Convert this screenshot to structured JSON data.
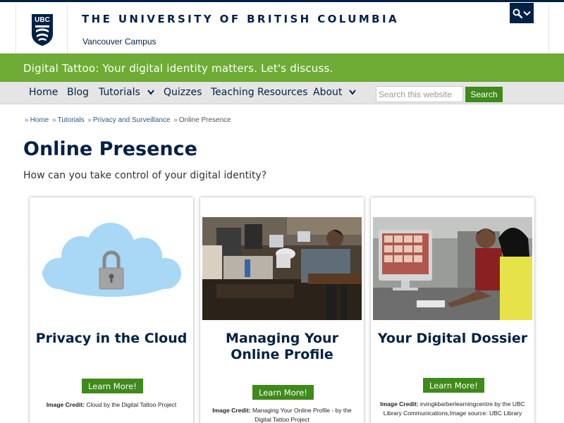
{
  "header": {
    "crest_text": "UBC",
    "university_name": "THE UNIVERSITY OF BRITISH COLUMBIA",
    "campus": "Vancouver Campus"
  },
  "banner": {
    "text": "Digital Tattoo: Your digital identity matters. Let's discuss."
  },
  "nav": {
    "items": [
      {
        "label": "Home"
      },
      {
        "label": "Blog"
      },
      {
        "label": "Tutorials"
      },
      {
        "label": "Quizzes"
      },
      {
        "label": "Teaching Resources"
      },
      {
        "label": "About"
      }
    ],
    "search_placeholder": "Search this website",
    "search_button": "Search"
  },
  "breadcrumb": {
    "prefix": "»",
    "items": [
      "Home",
      "Tutorials",
      "Privacy and Surveillance",
      "Online Presence"
    ]
  },
  "page": {
    "title": "Online Presence",
    "subtitle": "How can you take control of your digital identity?"
  },
  "cards": [
    {
      "title": "Privacy in the Cloud",
      "button": "Learn More!",
      "credit_label": "Image Credit:",
      "credit_text": "Cloud by the Digital Tattoo Project"
    },
    {
      "title": "Managing Your Online Profile",
      "button": "Learn More!",
      "credit_label": "Image Credit:",
      "credit_text": "Managing Your Online Profile - by the Digital Tattoo Project"
    },
    {
      "title": "Your Digital Dossier",
      "button": "Learn More!",
      "credit_label": "Image Credit:",
      "credit_text": "irvingkbarberlearningcentre by the UBC Library Communications,Image source: UBC Library"
    }
  ],
  "colors": {
    "navy": "#002145",
    "banner_green": "#6eac35",
    "button_green": "#3f8a1a",
    "nav_gray": "#e5e5e5"
  }
}
